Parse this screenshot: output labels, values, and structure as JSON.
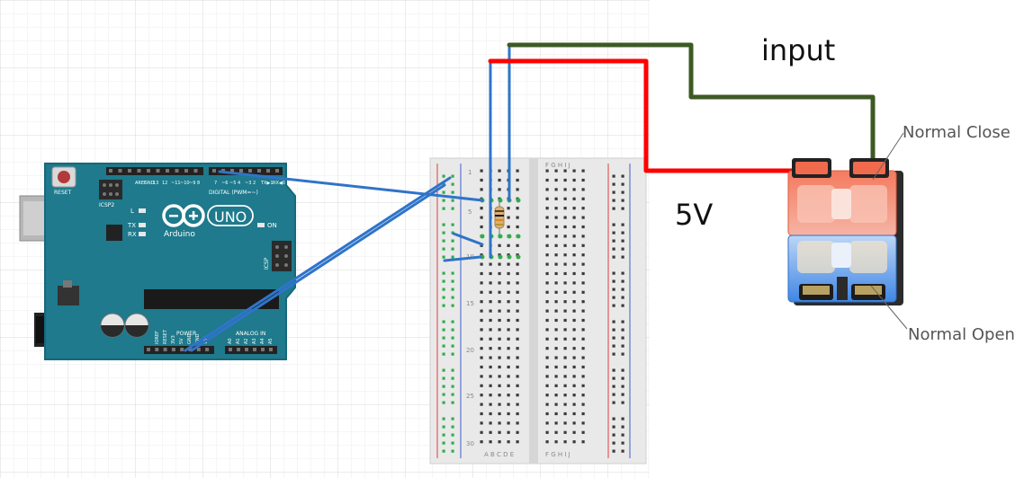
{
  "labels": {
    "input": "input",
    "five_v": "5V",
    "normal_close": "Normal Close",
    "normal_open": "Normal Open"
  },
  "arduino": {
    "reset": "RESET",
    "icsp2": "ICSP2",
    "icsp": "ICSP",
    "uno": "UNO",
    "brand": "Arduino",
    "digital": "DIGITAL (PWM=~)",
    "power": "POWER",
    "analog": "ANALOG IN",
    "led_l": "L",
    "led_tx": "TX",
    "led_rx": "RX",
    "led_on": "ON",
    "aref": "AREF",
    "gnd": "GND",
    "txd": "TX▶1",
    "rxd": "RX◀0",
    "pin_13": "13",
    "pin_12": "12",
    "pin_11": "~11",
    "pin_10": "~10",
    "pin_9": "~9",
    "pin_8": "8",
    "pin_7": "7",
    "pin_6": "~6",
    "pin_5": "~5",
    "pin_4": "4",
    "pin_3": "~3",
    "pin_2": "2",
    "ioref": "IOREF",
    "rst": "RESET",
    "v33": "3V3",
    "v5": "5V",
    "gnd1": "GND",
    "gnd2": "GND",
    "vin": "VIN",
    "a0": "A0",
    "a1": "A1",
    "a2": "A2",
    "a3": "A3",
    "a4": "A4",
    "a5": "A5"
  },
  "breadboard": {
    "row_1": "1",
    "row_5": "5",
    "row_10": "10",
    "row_15": "15",
    "row_20": "20",
    "row_25": "25",
    "row_30": "30",
    "cols_left": "A B C D E",
    "cols_right": "F G H I J"
  },
  "colors": {
    "background_grid": "#e6e6e6",
    "pcb": "#1e7a8c",
    "pcb_edge": "#17687a",
    "wire_blue": "#2f74c9",
    "wire_red": "#ff0000",
    "wire_green": "#3d5a23",
    "switch_top": "#f06a4e",
    "switch_bottom": "#4d90e8"
  }
}
